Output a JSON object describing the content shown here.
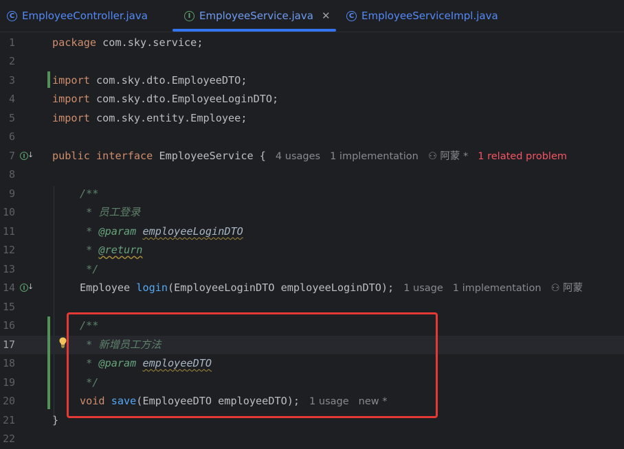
{
  "tabs": [
    {
      "label": "EmployeeController.java",
      "kind": "class"
    },
    {
      "label": "EmployeeService.java",
      "kind": "interface",
      "active": true
    },
    {
      "label": "EmployeeServiceImpl.java",
      "kind": "class"
    }
  ],
  "icons": {
    "class": "C",
    "interface": "I",
    "close": "✕"
  },
  "line_numbers": [
    "1",
    "2",
    "3",
    "4",
    "5",
    "6",
    "7",
    "8",
    "9",
    "10",
    "11",
    "12",
    "13",
    "14",
    "15",
    "16",
    "17",
    "18",
    "19",
    "20",
    "21",
    "22"
  ],
  "code": {
    "l1": {
      "kw": "package",
      "rest": " com.sky.service;"
    },
    "l3": {
      "kw": "import",
      "rest": " com.sky.dto.EmployeeDTO;"
    },
    "l4": {
      "kw": "import",
      "rest": " com.sky.dto.EmployeeLoginDTO;"
    },
    "l5": {
      "kw": "import",
      "rest": " com.sky.entity.Employee;"
    },
    "l7": {
      "kw1": "public",
      "kw2": "interface",
      "name": " EmployeeService {",
      "hint_usages": "4 usages",
      "hint_impl": "1 implementation",
      "hint_author": "阿蒙 *",
      "hint_problem": "1 related problem"
    },
    "l9": "/**",
    "l10": " * 员工登录",
    "l11": {
      "star": " * ",
      "tag": "@param",
      "param": "employeeLoginDTO"
    },
    "l12": {
      "star": " * ",
      "tag": "@return"
    },
    "l13": " */",
    "l14": {
      "type": "Employee ",
      "fn": "login",
      "rest": "(EmployeeLoginDTO employeeLoginDTO);",
      "hint_usages": "1 usage",
      "hint_impl": "1 implementation",
      "hint_author": "阿蒙"
    },
    "l16": "/**",
    "l17": " * 新增员工方法",
    "l18": {
      "star": " * ",
      "tag": "@param",
      "param": "employeeDTO"
    },
    "l19": " */",
    "l20": {
      "kw": "void ",
      "fn": "save",
      "rest": "(EmployeeDTO employeeDTO);",
      "hint_usages": "1 usage",
      "hint_new": "new *"
    },
    "l21": "}"
  },
  "colors": {
    "accent": "#3574f0",
    "highlight_box": "#e53935",
    "keyword": "#cf8e6d",
    "function": "#56a8f5",
    "doc_comment": "#5f826b",
    "error_hint": "#f75464"
  }
}
